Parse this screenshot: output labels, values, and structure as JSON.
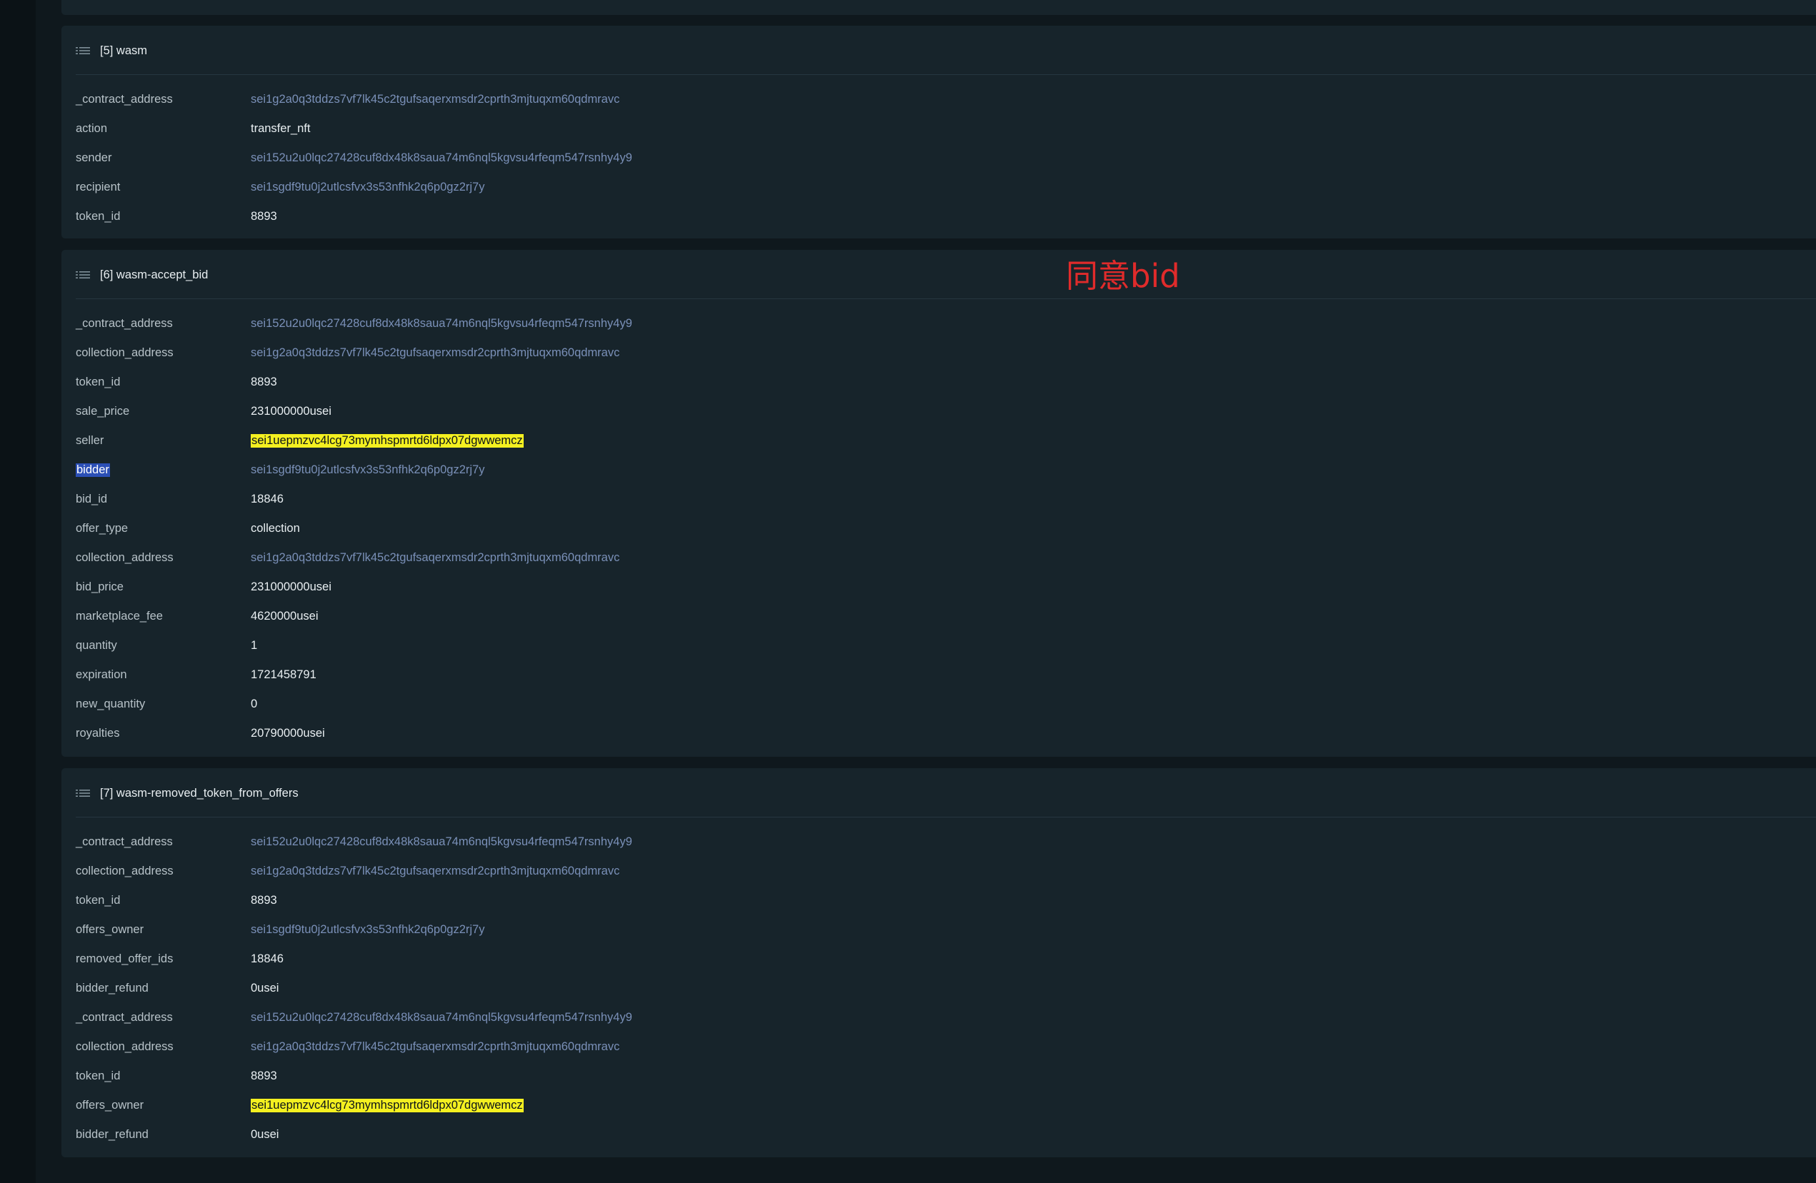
{
  "events": [
    {
      "title": "[5] wasm",
      "attributes": [
        {
          "key": "_contract_address",
          "value": "sei1g2a0q3tddzs7vf7lk45c2tgufsaqerxmsdr2cprth3mjtuqxm60qdmravc",
          "link": true
        },
        {
          "key": "action",
          "value": "transfer_nft",
          "link": false
        },
        {
          "key": "sender",
          "value": "sei152u2u0lqc27428cuf8dx48k8saua74m6nql5kgvsu4rfeqm547rsnhy4y9",
          "link": true
        },
        {
          "key": "recipient",
          "value": "sei1sgdf9tu0j2utlcsfvx3s53nfhk2q6p0gz2rj7y",
          "link": true
        },
        {
          "key": "token_id",
          "value": "8893",
          "link": false
        }
      ]
    },
    {
      "title": "[6] wasm-accept_bid",
      "attributes": [
        {
          "key": "_contract_address",
          "value": "sei152u2u0lqc27428cuf8dx48k8saua74m6nql5kgvsu4rfeqm547rsnhy4y9",
          "link": true
        },
        {
          "key": "collection_address",
          "value": "sei1g2a0q3tddzs7vf7lk45c2tgufsaqerxmsdr2cprth3mjtuqxm60qdmravc",
          "link": true
        },
        {
          "key": "token_id",
          "value": "8893",
          "link": false
        },
        {
          "key": "sale_price",
          "value": "231000000usei",
          "link": false
        },
        {
          "key": "seller",
          "value": "sei1uepmzvc4lcg73mymhspmrtd6ldpx07dgwwemcz",
          "link": false,
          "highlight": "yellow"
        },
        {
          "key": "bidder",
          "value": "sei1sgdf9tu0j2utlcsfvx3s53nfhk2q6p0gz2rj7y",
          "link": true,
          "key_highlight": "blue"
        },
        {
          "key": "bid_id",
          "value": "18846",
          "link": false
        },
        {
          "key": "offer_type",
          "value": "collection",
          "link": false
        },
        {
          "key": "collection_address",
          "value": "sei1g2a0q3tddzs7vf7lk45c2tgufsaqerxmsdr2cprth3mjtuqxm60qdmravc",
          "link": true
        },
        {
          "key": "bid_price",
          "value": "231000000usei",
          "link": false
        },
        {
          "key": "marketplace_fee",
          "value": "4620000usei",
          "link": false
        },
        {
          "key": "quantity",
          "value": "1",
          "link": false
        },
        {
          "key": "expiration",
          "value": "1721458791",
          "link": false
        },
        {
          "key": "new_quantity",
          "value": "0",
          "link": false
        },
        {
          "key": "royalties",
          "value": "20790000usei",
          "link": false
        }
      ]
    },
    {
      "title": "[7] wasm-removed_token_from_offers",
      "attributes": [
        {
          "key": "_contract_address",
          "value": "sei152u2u0lqc27428cuf8dx48k8saua74m6nql5kgvsu4rfeqm547rsnhy4y9",
          "link": true
        },
        {
          "key": "collection_address",
          "value": "sei1g2a0q3tddzs7vf7lk45c2tgufsaqerxmsdr2cprth3mjtuqxm60qdmravc",
          "link": true
        },
        {
          "key": "token_id",
          "value": "8893",
          "link": false
        },
        {
          "key": "offers_owner",
          "value": "sei1sgdf9tu0j2utlcsfvx3s53nfhk2q6p0gz2rj7y",
          "link": true
        },
        {
          "key": "removed_offer_ids",
          "value": "18846",
          "link": false
        },
        {
          "key": "bidder_refund",
          "value": "0usei",
          "link": false
        },
        {
          "key": "_contract_address",
          "value": "sei152u2u0lqc27428cuf8dx48k8saua74m6nql5kgvsu4rfeqm547rsnhy4y9",
          "link": true
        },
        {
          "key": "collection_address",
          "value": "sei1g2a0q3tddzs7vf7lk45c2tgufsaqerxmsdr2cprth3mjtuqxm60qdmravc",
          "link": true
        },
        {
          "key": "token_id",
          "value": "8893",
          "link": false
        },
        {
          "key": "offers_owner",
          "value": "sei1uepmzvc4lcg73mymhspmrtd6ldpx07dgwwemcz",
          "link": false,
          "highlight": "yellow"
        },
        {
          "key": "bidder_refund",
          "value": "0usei",
          "link": false
        }
      ]
    }
  ],
  "annotation": {
    "text": "同意bid",
    "color": "#e02b2b"
  },
  "colors": {
    "background": "#0f181d",
    "card": "#17242b",
    "link": "#7a90b8",
    "highlight_yellow": "#f4f020",
    "highlight_blue": "#2b4fb6"
  },
  "icons": {
    "event_header": "list-icon"
  }
}
